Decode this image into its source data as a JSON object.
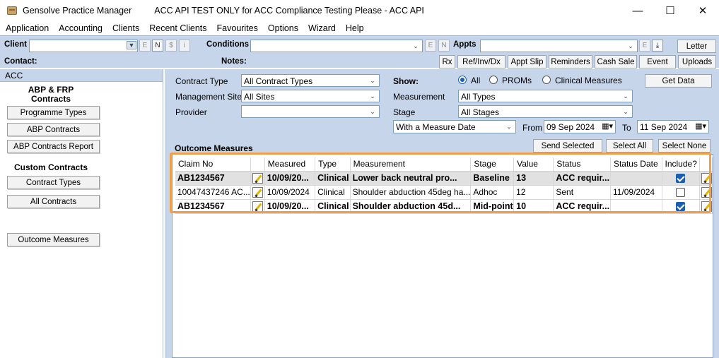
{
  "window": {
    "app_name": "Gensolve Practice Manager",
    "title": "ACC API TEST ONLY for ACC Compliance Testing Please - ACC API",
    "minimize": "—",
    "maximize": "☐",
    "close": "✕"
  },
  "menu": [
    "Application",
    "Accounting",
    "Clients",
    "Recent Clients",
    "Favourites",
    "Options",
    "Wizard",
    "Help"
  ],
  "toolbar": {
    "client_label": "Client",
    "conditions_label": "Conditions",
    "appts_label": "Appts",
    "contact_label": "Contact:",
    "notes_label": "Notes:",
    "mini_e": "E",
    "mini_n": "N",
    "mini_s": "$",
    "mini_i": "i",
    "letter": "Letter",
    "buttons": [
      "Rx",
      "Ref/Inv/Dx",
      "Appt Slip",
      "Reminders",
      "Cash Sale",
      "Event",
      "Uploads"
    ]
  },
  "left": {
    "header": "ACC",
    "heading1": "ABP & FRP Contracts",
    "btn_programme_types": "Programme Types",
    "btn_abp_contracts": "ABP Contracts",
    "btn_abp_report": "ABP Contracts Report",
    "heading2": "Custom Contracts",
    "btn_contract_types": "Contract Types",
    "btn_all_contracts": "All Contracts",
    "btn_outcome_measures": "Outcome Measures"
  },
  "filters": {
    "contract_type_label": "Contract Type",
    "contract_type_value": "All Contract Types",
    "management_site_label": "Management Site",
    "management_site_value": "All Sites",
    "provider_label": "Provider",
    "provider_value": "",
    "show_label": "Show:",
    "radio_all": "All",
    "radio_proms": "PROMs",
    "radio_clinical": "Clinical Measures",
    "get_data": "Get Data",
    "measurement_label": "Measurement",
    "measurement_value": "All Types",
    "stage_label": "Stage",
    "stage_value": "All Stages",
    "date_filter_value": "With a Measure Date",
    "from_label": "From",
    "from_value": "09 Sep 2024",
    "to_label": "To",
    "to_value": "11 Sep 2024"
  },
  "outcome": {
    "title": "Outcome Measures",
    "send_selected": "Send Selected",
    "select_all": "Select All",
    "select_none": "Select None",
    "columns": [
      "Claim No",
      "",
      "Measured",
      "Type",
      "Measurement",
      "Stage",
      "Value",
      "Status",
      "Status Date",
      "Include?",
      ""
    ],
    "rows": [
      {
        "claim": "AB1234567",
        "measured": "10/09/20...",
        "type": "Clinical",
        "measurement": "Lower back neutral pro...",
        "stage": "Baseline",
        "value": "13",
        "status": "ACC requir...",
        "status_date": "",
        "include": true
      },
      {
        "claim": "10047437246 AC...",
        "measured": "10/09/2024",
        "type": "Clinical",
        "measurement": "Shoulder abduction 45deg ha...",
        "stage": "Adhoc",
        "value": "12",
        "status": "Sent",
        "status_date": "11/09/2024",
        "include": false
      },
      {
        "claim": "AB1234567",
        "measured": "10/09/20...",
        "type": "Clinical",
        "measurement": "Shoulder abduction 45d...",
        "stage": "Mid-point",
        "value": "10",
        "status": "ACC requir...",
        "status_date": "",
        "include": true
      }
    ]
  }
}
